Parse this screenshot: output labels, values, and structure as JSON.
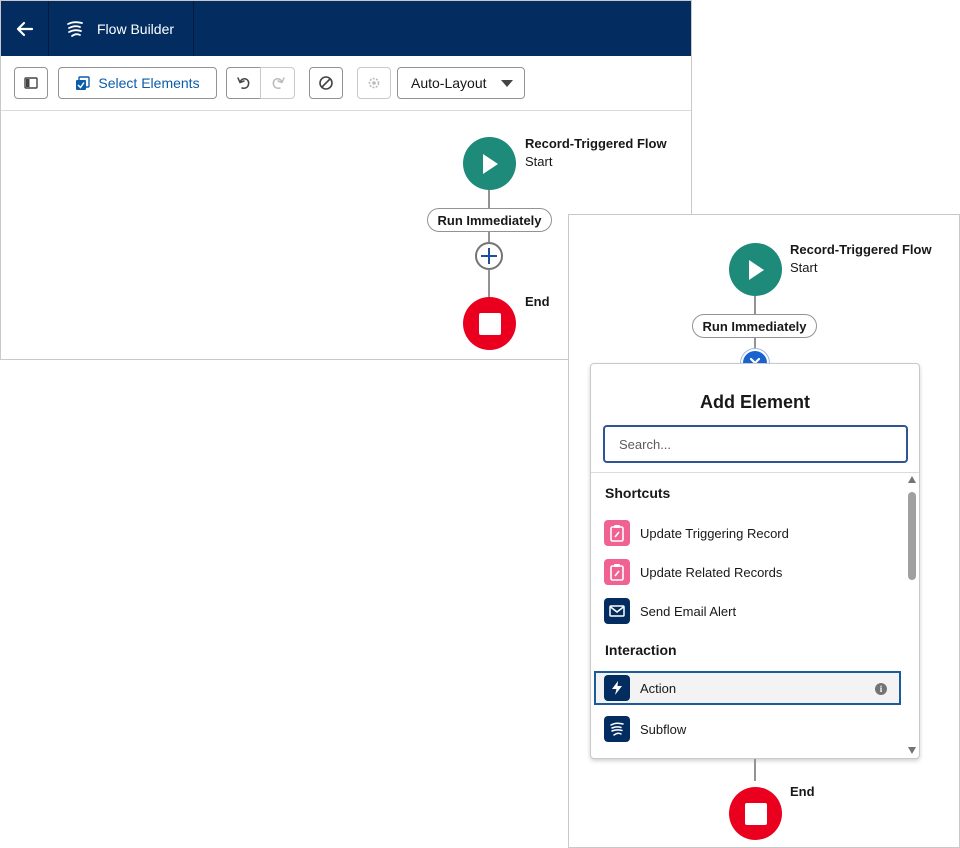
{
  "app": {
    "title": "Flow Builder"
  },
  "toolbar": {
    "select_elements_label": "Select Elements",
    "layout_mode": "Auto-Layout"
  },
  "flow": {
    "start_title": "Record-Triggered Flow",
    "start_subtitle": "Start",
    "path_label": "Run Immediately",
    "end_label": "End"
  },
  "add_element": {
    "title": "Add Element",
    "search_placeholder": "Search...",
    "sections": [
      {
        "heading": "Shortcuts",
        "items": [
          {
            "label": "Update Triggering Record",
            "icon": "record-update-icon"
          },
          {
            "label": "Update Related Records",
            "icon": "record-update-icon"
          },
          {
            "label": "Send Email Alert",
            "icon": "email-icon"
          }
        ]
      },
      {
        "heading": "Interaction",
        "items": [
          {
            "label": "Action",
            "icon": "lightning-icon",
            "selected": true
          },
          {
            "label": "Subflow",
            "icon": "flow-icon"
          }
        ]
      }
    ]
  },
  "colors": {
    "header": "#032d60",
    "start": "#1e8a7a",
    "end": "#ea001e",
    "accent": "#0b5cab",
    "pink_icon": "#f06292",
    "navy_icon": "#032d60",
    "close": "#1b62d1"
  }
}
